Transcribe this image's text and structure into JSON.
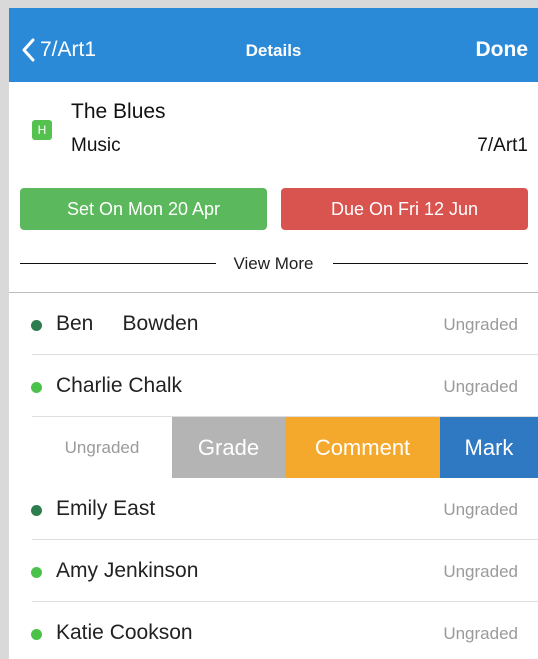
{
  "nav": {
    "back_label": "7/Art1",
    "title": "Details",
    "done_label": "Done"
  },
  "assignment": {
    "badge": "H",
    "title": "The Blues",
    "subject": "Music",
    "class_code": "7/Art1",
    "set_label": "Set On Mon 20 Apr",
    "due_label": "Due On Fri 12 Jun",
    "view_more_label": "View More"
  },
  "students": [
    {
      "name": "Ben     Bowden",
      "status": "Ungraded",
      "dot_color": "#2e7d4f"
    },
    {
      "name": "Charlie Chalk",
      "status": "Ungraded",
      "dot_color": "#4cc24a"
    },
    {
      "name": "Emily East",
      "status": "Ungraded",
      "dot_color": "#2e7d4f"
    },
    {
      "name": "Amy Jenkinson",
      "status": "Ungraded",
      "dot_color": "#4cc24a"
    },
    {
      "name": "Katie Cookson",
      "status": "Ungraded",
      "dot_color": "#4cc24a"
    }
  ],
  "swipe": {
    "status": "Ungraded",
    "grade_label": "Grade",
    "comment_label": "Comment",
    "mark_label": "Mark"
  },
  "colors": {
    "navbar": "#2b8ad8",
    "set_button": "#5cb85c",
    "due_button": "#d9534f",
    "grade_action": "#b4b4b4",
    "comment_action": "#f4a82c",
    "mark_action": "#2f78c2"
  }
}
